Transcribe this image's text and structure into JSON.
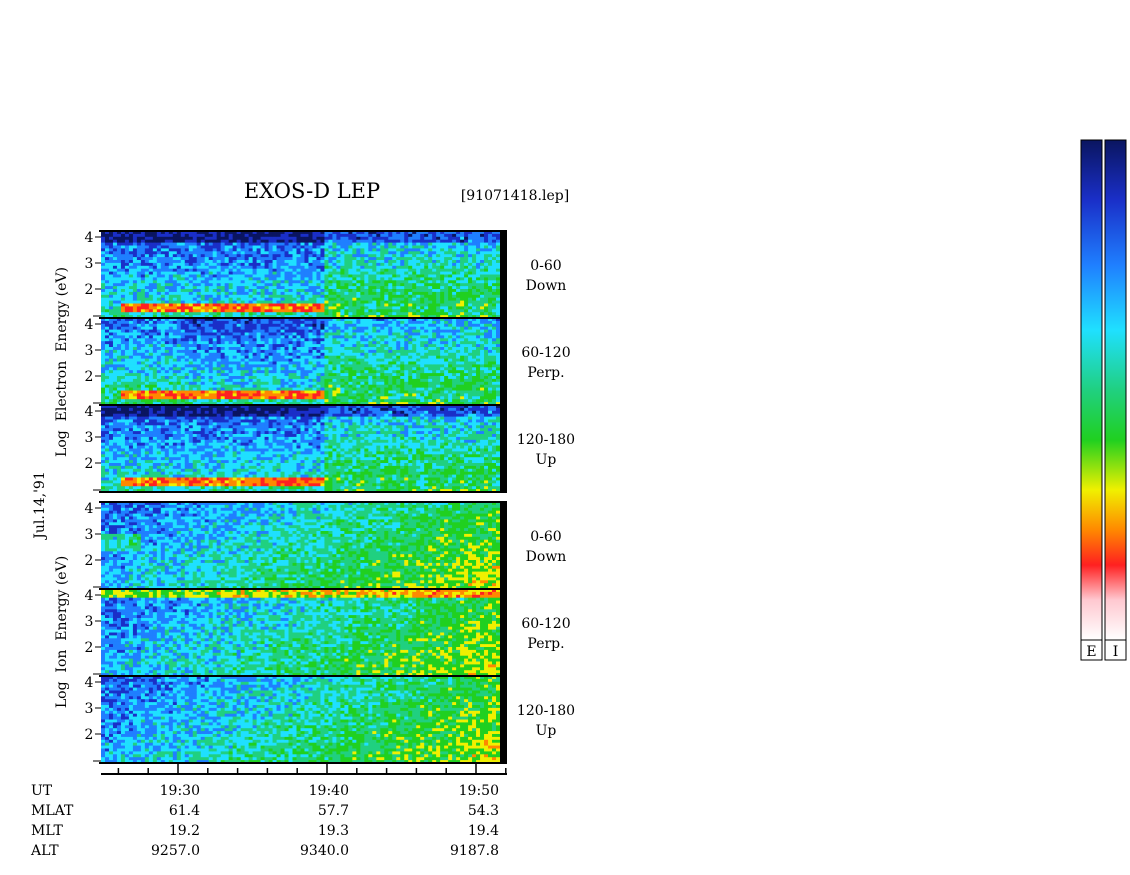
{
  "chart_data": {
    "type": "heatmap",
    "title": "EXOS-D LEP",
    "file_label": "[91071418.lep]",
    "date_label": "Jul.14,'91",
    "electron_ylabel": "Log  Electron  Energy (eV)",
    "ion_ylabel": "Log  Ion  Energy (eV)",
    "y_ticks": [
      "4",
      "3",
      "2"
    ],
    "x_range_ut": [
      "19:25",
      "19:52"
    ],
    "panels": [
      {
        "species": "Electron",
        "angle": "0-60",
        "direction": "Down"
      },
      {
        "species": "Electron",
        "angle": "60-120",
        "direction": "Perp."
      },
      {
        "species": "Electron",
        "angle": "120-180",
        "direction": "Up"
      },
      {
        "species": "Ion",
        "angle": "0-60",
        "direction": "Down"
      },
      {
        "species": "Ion",
        "angle": "60-120",
        "direction": "Perp."
      },
      {
        "species": "Ion",
        "angle": "120-180",
        "direction": "Up"
      }
    ],
    "ephemeris": {
      "row_labels": [
        "UT",
        "MLAT",
        "MLT",
        "ALT"
      ],
      "columns": [
        {
          "UT": "19:30",
          "MLAT": "61.4",
          "MLT": "19.2",
          "ALT": "9257.0"
        },
        {
          "UT": "19:40",
          "MLAT": "57.7",
          "MLT": "19.3",
          "ALT": "9340.0"
        },
        {
          "UT": "19:50",
          "MLAT": "54.3",
          "MLT": "19.4",
          "ALT": "9187.8"
        }
      ]
    },
    "colorbars": [
      {
        "label": "E"
      },
      {
        "label": "I"
      }
    ],
    "colorscale": [
      "#0a1560",
      "#1a2fc8",
      "#1f7fff",
      "#1fe0ff",
      "#20d080",
      "#20d020",
      "#f0f000",
      "#ff8800",
      "#ff2020",
      "#ffc8d0",
      "#ffffff"
    ]
  }
}
